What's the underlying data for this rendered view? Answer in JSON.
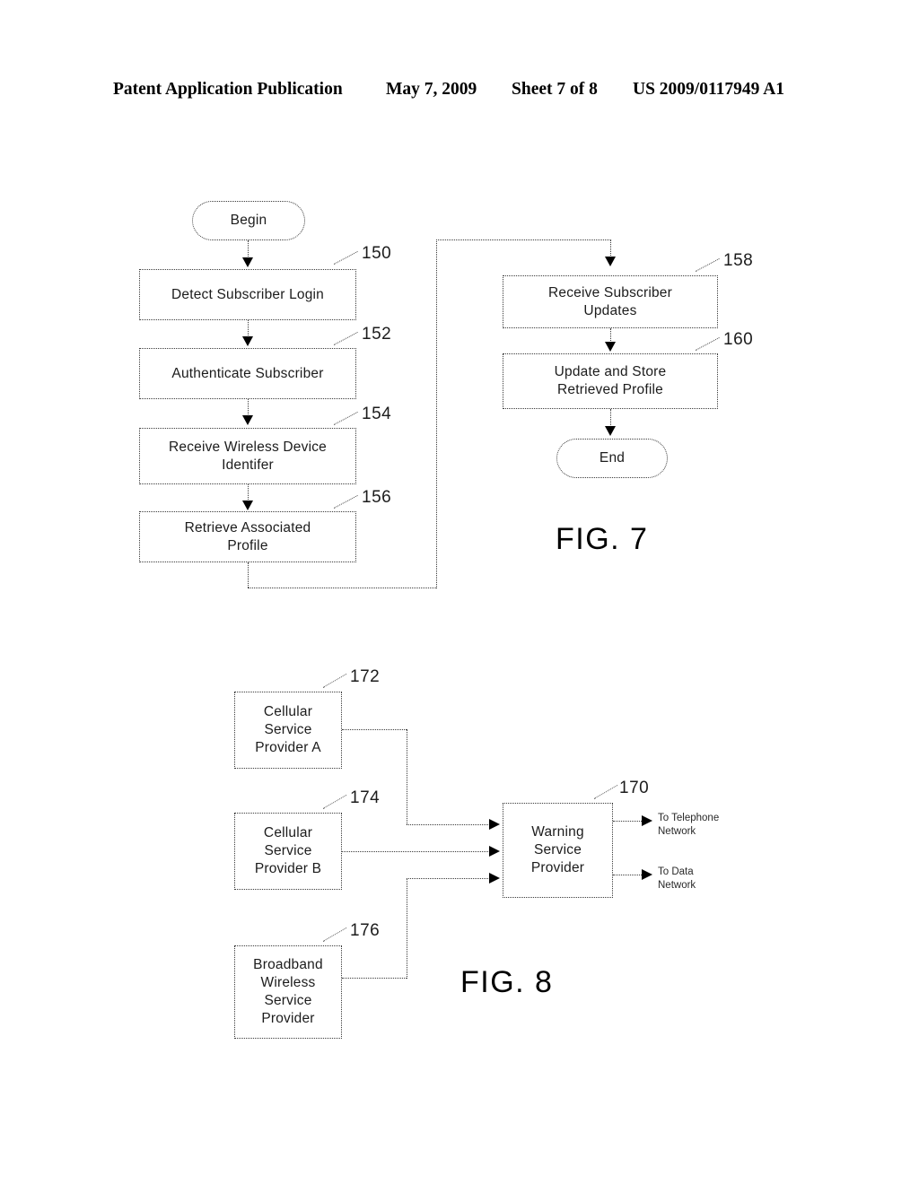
{
  "header": {
    "publication": "Patent Application Publication",
    "date": "May 7, 2009",
    "sheet": "Sheet 7 of 8",
    "patent_number": "US 2009/0117949 A1"
  },
  "figures": [
    {
      "caption": "FIG. 7",
      "nodes": {
        "begin": {
          "label": "Begin",
          "shape": "oval"
        },
        "step150": {
          "label": "Detect Subscriber Login",
          "ref": "150",
          "shape": "rect"
        },
        "step152": {
          "label": "Authenticate Subscriber",
          "ref": "152",
          "shape": "rect"
        },
        "step154": {
          "label": "Receive Wireless Device\nIdentifer",
          "ref": "154",
          "shape": "rect"
        },
        "step156": {
          "label": "Retrieve Associated\nProfile",
          "ref": "156",
          "shape": "rect"
        },
        "step158": {
          "label": "Receive Subscriber\nUpdates",
          "ref": "158",
          "shape": "rect"
        },
        "step160": {
          "label": "Update and Store\nRetrieved Profile",
          "ref": "160",
          "shape": "rect"
        },
        "end": {
          "label": "End",
          "shape": "oval"
        }
      }
    },
    {
      "caption": "FIG. 8",
      "nodes": {
        "provider172": {
          "label": "Cellular\nService\nProvider A",
          "ref": "172",
          "shape": "rect"
        },
        "provider174": {
          "label": "Cellular\nService\nProvider B",
          "ref": "174",
          "shape": "rect"
        },
        "provider176": {
          "label": "Broadband\nWireless\nService\nProvider",
          "ref": "176",
          "shape": "rect"
        },
        "warning170": {
          "label": "Warning\nService\nProvider",
          "ref": "170",
          "shape": "rect"
        }
      },
      "outputs": {
        "telephone": "To Telephone\nNetwork",
        "data": "To Data\nNetwork"
      }
    }
  ],
  "colors": {
    "ink": "#000000",
    "line": "#3a3a3a",
    "paper": "#ffffff"
  }
}
